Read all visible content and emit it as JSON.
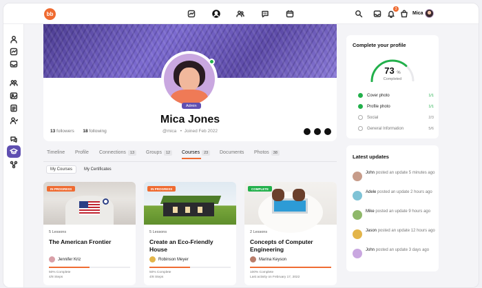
{
  "header": {
    "logo_text": "bb",
    "user_name": "Mica",
    "notification_count": "3"
  },
  "profile": {
    "name": "Mica Jones",
    "role_badge": "Admin",
    "followers_count": "13",
    "followers_label": "followers",
    "following_count": "18",
    "following_label": "following",
    "handle": "@mica",
    "joined": "Joined Feb 2022"
  },
  "tabs": [
    {
      "label": "Timeline",
      "count": ""
    },
    {
      "label": "Profile",
      "count": ""
    },
    {
      "label": "Connections",
      "count": "13"
    },
    {
      "label": "Groups",
      "count": "12"
    },
    {
      "label": "Courses",
      "count": "23"
    },
    {
      "label": "Documents",
      "count": ""
    },
    {
      "label": "Photos",
      "count": "38"
    }
  ],
  "subtabs": [
    "My Courses",
    "My Certificates"
  ],
  "courses": [
    {
      "status": "IN PROGRESS",
      "lessons": "5 Lessons",
      "title": "The American Frontier",
      "author": "Jennifer Kriz",
      "progress_pct": 50,
      "complete_text": "50% Complete",
      "meta": "4/8 Steps"
    },
    {
      "status": "IN PROGRESS",
      "lessons": "5 Lessons",
      "title": "Create an Eco-Friendly House",
      "author": "Robinson Meyer",
      "progress_pct": 50,
      "complete_text": "50% Complete",
      "meta": "4/8 Steps"
    },
    {
      "status": "COMPLETE",
      "lessons": "2 Lessons",
      "title": "Concepts of Computer Engineering",
      "author": "Marina Keyson",
      "progress_pct": 100,
      "complete_text": "100% Complete",
      "meta": "Last activity on February 17, 2022"
    }
  ],
  "complete_profile": {
    "title": "Complete your profile",
    "percent": "73",
    "percent_sign": "%",
    "completed_label": "Completed",
    "progress_fraction": 0.73,
    "items": [
      {
        "label": "Cover photo",
        "score": "1/1",
        "done": true
      },
      {
        "label": "Profile photo",
        "score": "1/1",
        "done": true
      },
      {
        "label": "Social",
        "score": "2/3",
        "done": false
      },
      {
        "label": "General Information",
        "score": "5/6",
        "done": false
      }
    ]
  },
  "latest_updates": {
    "title": "Latest updates",
    "items": [
      {
        "name": "John",
        "action": "posted an update",
        "time": "5 minutes ago"
      },
      {
        "name": "Adele",
        "action": "posted an update",
        "time": "2 hours ago"
      },
      {
        "name": "Mike",
        "action": "posted an update",
        "time": "9 hours ago"
      },
      {
        "name": "Jason",
        "action": "posted an update",
        "time": "12 hours ago"
      },
      {
        "name": "John",
        "action": "posted an update",
        "time": "3 days ago"
      }
    ]
  },
  "colors": {
    "accent": "#ef6b31",
    "brand_purple": "#5f4fb1",
    "success": "#22b04b"
  }
}
